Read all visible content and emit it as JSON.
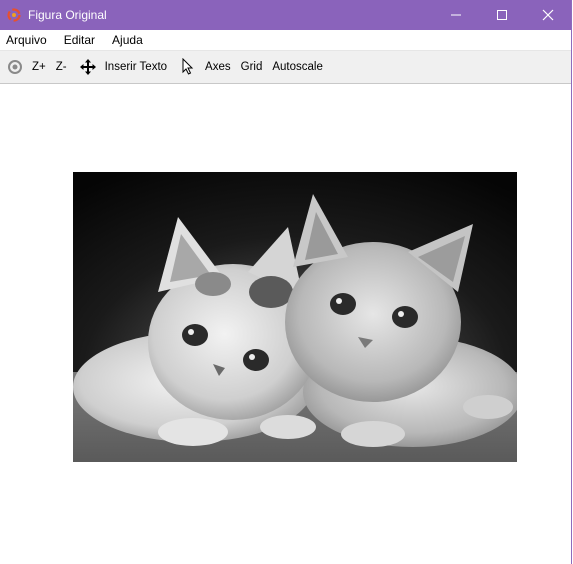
{
  "window": {
    "title": "Figura Original",
    "icon": "app-logo-icon"
  },
  "controls": {
    "minimize": "minimize-icon",
    "maximize": "maximize-icon",
    "close": "close-icon"
  },
  "menu": {
    "items": [
      "Arquivo",
      "Editar",
      "Ajuda"
    ]
  },
  "toolbar": {
    "reset_icon": "reset-view-icon",
    "zoom_in": "Z+",
    "zoom_out": "Z-",
    "pan_icon": "move-arrows-icon",
    "insert_text": "Inserir Texto",
    "pointer_icon": "pointer-cursor-icon",
    "axes": "Axes",
    "grid": "Grid",
    "autoscale": "Autoscale"
  },
  "figure": {
    "description_icon": "grayscale-photo",
    "colors": {
      "title_bar": "#8a63bb"
    }
  }
}
